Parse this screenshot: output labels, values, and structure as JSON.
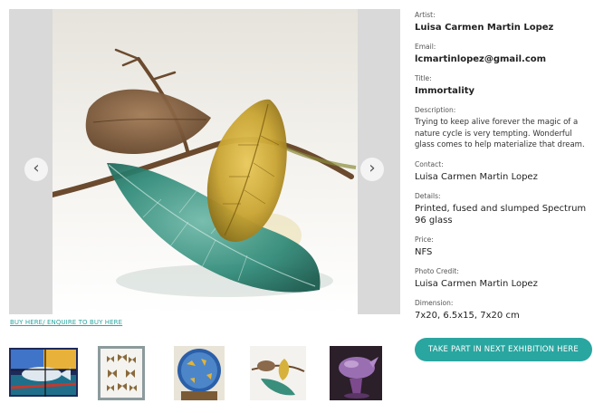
{
  "gallery": {
    "prev_icon": "chevron-left-icon",
    "next_icon": "chevron-right-icon",
    "buy_link": "BUY HERE/ ENQUIRE TO BUY HERE",
    "thumbnails": [
      "stained-glass-fish",
      "framed-butterflies",
      "glass-plate-blue",
      "leaves-on-branch",
      "purple-glass-bird"
    ]
  },
  "details": {
    "artist_label": "Artist:",
    "artist_value": "Luisa Carmen Martin Lopez",
    "email_label": "Email:",
    "email_value": "lcmartinlopez@gmail.com",
    "title_label": "Title:",
    "title_value": "Immortality",
    "description_label": "Description:",
    "description_value": "Trying to keep alive forever the magic of a nature cycle is very tempting. Wonderful glass comes to help materialize that dream.",
    "contact_label": "Contact:",
    "contact_value": "Luisa Carmen Martin Lopez",
    "details_label": "Details:",
    "details_value": "Printed, fused and slumped Spectrum 96 glass",
    "price_label": "Price:",
    "price_value": "NFS",
    "photo_credit_label": "Photo Credit:",
    "photo_credit_value": "Luisa Carmen Martin Lopez",
    "dimension_label": "Dimension:",
    "dimension_value": "7x20, 6.5x15, 7x20 cm"
  },
  "cta_label": "TAKE PART IN NEXT EXHIBITION HERE",
  "colors": {
    "accent": "#2aa6a0",
    "frame": "#d9d9d9"
  }
}
